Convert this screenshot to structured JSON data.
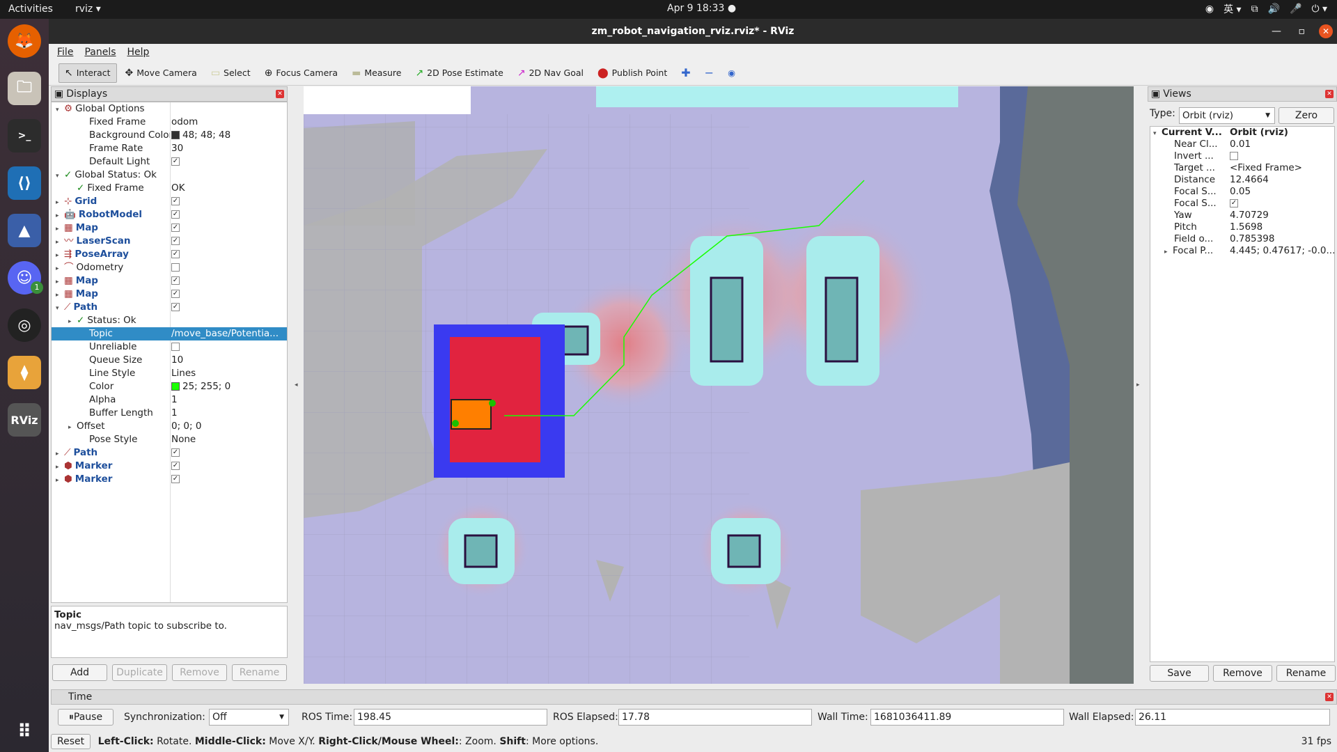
{
  "topbar": {
    "activities": "Activities",
    "app": "rviz ▾",
    "clock": "Apr 9  18:33  ●",
    "lang": "英 ▾"
  },
  "window": {
    "title": "zm_robot_navigation_rviz.rviz* - RViz"
  },
  "menu": [
    "File",
    "Panels",
    "Help"
  ],
  "toolbar": [
    {
      "label": "Interact",
      "icon": "cursor-icon",
      "glyph": "↖"
    },
    {
      "label": "Move Camera",
      "icon": "move-camera-icon",
      "glyph": "✥"
    },
    {
      "label": "Select",
      "icon": "select-icon",
      "glyph": "▭"
    },
    {
      "label": "Focus Camera",
      "icon": "focus-icon",
      "glyph": "⊕"
    },
    {
      "label": "Measure",
      "icon": "ruler-icon",
      "glyph": "▬"
    },
    {
      "label": "2D Pose Estimate",
      "icon": "pose-arrow-icon",
      "glyph": "↗"
    },
    {
      "label": "2D Nav Goal",
      "icon": "goal-arrow-icon",
      "glyph": "↗"
    },
    {
      "label": "Publish Point",
      "icon": "pin-icon",
      "glyph": "📍"
    }
  ],
  "displays": {
    "title": "Displays",
    "rows": [
      {
        "indent": 0,
        "arrow": "▾",
        "icon": "⚙",
        "label": "Global Options",
        "value": "",
        "bold": false
      },
      {
        "indent": 2,
        "arrow": "",
        "icon": "",
        "label": "Fixed Frame",
        "value": "odom"
      },
      {
        "indent": 2,
        "arrow": "",
        "icon": "",
        "label": "Background Color",
        "value": "48; 48; 48",
        "swatch": "#303030"
      },
      {
        "indent": 2,
        "arrow": "",
        "icon": "",
        "label": "Frame Rate",
        "value": "30"
      },
      {
        "indent": 2,
        "arrow": "",
        "icon": "",
        "label": "Default Light",
        "value": "",
        "check": true
      },
      {
        "indent": 0,
        "arrow": "▾",
        "icon": "✓",
        "label": "Global Status: Ok",
        "value": ""
      },
      {
        "indent": 1,
        "arrow": "",
        "icon": "✓",
        "label": "Fixed Frame",
        "value": "OK"
      },
      {
        "indent": 0,
        "arrow": "▸",
        "icon": "⊹",
        "label": "Grid",
        "value": "",
        "check": true,
        "blue": true
      },
      {
        "indent": 0,
        "arrow": "▸",
        "icon": "🤖",
        "label": "RobotModel",
        "value": "",
        "check": true,
        "blue": true
      },
      {
        "indent": 0,
        "arrow": "▸",
        "icon": "▦",
        "label": "Map",
        "value": "",
        "check": true,
        "blue": true
      },
      {
        "indent": 0,
        "arrow": "▸",
        "icon": "〰",
        "label": "LaserScan",
        "value": "",
        "check": true,
        "blue": true
      },
      {
        "indent": 0,
        "arrow": "▸",
        "icon": "⇶",
        "label": "PoseArray",
        "value": "",
        "check": true,
        "blue": true
      },
      {
        "indent": 0,
        "arrow": "▸",
        "icon": "⌒",
        "label": "Odometry",
        "value": "",
        "check": false
      },
      {
        "indent": 0,
        "arrow": "▸",
        "icon": "▦",
        "label": "Map",
        "value": "",
        "check": true,
        "blue": true
      },
      {
        "indent": 0,
        "arrow": "▸",
        "icon": "▦",
        "label": "Map",
        "value": "",
        "check": true,
        "blue": true
      },
      {
        "indent": 0,
        "arrow": "▾",
        "icon": "⟋",
        "label": "Path",
        "value": "",
        "check": true,
        "blue": true
      },
      {
        "indent": 1,
        "arrow": "▸",
        "icon": "✓",
        "label": "Status: Ok",
        "value": ""
      },
      {
        "indent": 2,
        "arrow": "",
        "icon": "",
        "label": "Topic",
        "value": "/move_base/Potentia...",
        "selected": true
      },
      {
        "indent": 2,
        "arrow": "",
        "icon": "",
        "label": "Unreliable",
        "value": "",
        "check": false
      },
      {
        "indent": 2,
        "arrow": "",
        "icon": "",
        "label": "Queue Size",
        "value": "10"
      },
      {
        "indent": 2,
        "arrow": "",
        "icon": "",
        "label": "Line Style",
        "value": "Lines"
      },
      {
        "indent": 2,
        "arrow": "",
        "icon": "",
        "label": "Color",
        "value": "25; 255; 0",
        "swatch": "#19ff00"
      },
      {
        "indent": 2,
        "arrow": "",
        "icon": "",
        "label": "Alpha",
        "value": "1"
      },
      {
        "indent": 2,
        "arrow": "",
        "icon": "",
        "label": "Buffer Length",
        "value": "1"
      },
      {
        "indent": 1,
        "arrow": "▸",
        "icon": "",
        "label": "Offset",
        "value": "0; 0; 0"
      },
      {
        "indent": 2,
        "arrow": "",
        "icon": "",
        "label": "Pose Style",
        "value": "None"
      },
      {
        "indent": 0,
        "arrow": "▸",
        "icon": "⟋",
        "label": "Path",
        "value": "",
        "check": true,
        "blue": true
      },
      {
        "indent": 0,
        "arrow": "▸",
        "icon": "⬢",
        "label": "Marker",
        "value": "",
        "check": true,
        "blue": true
      },
      {
        "indent": 0,
        "arrow": "▸",
        "icon": "⬢",
        "label": "Marker",
        "value": "",
        "check": true,
        "blue": true
      }
    ],
    "help_title": "Topic",
    "help_text": "nav_msgs/Path topic to subscribe to.",
    "buttons": {
      "add": "Add",
      "duplicate": "Duplicate",
      "remove": "Remove",
      "rename": "Rename"
    }
  },
  "views": {
    "title": "Views",
    "type_label": "Type:",
    "type_value": "Orbit (rviz)",
    "zero": "Zero",
    "rows": [
      {
        "arrow": "▾",
        "label": "Current V...",
        "value": "Orbit (rviz)",
        "bold": true
      },
      {
        "arrow": "",
        "label": "Near Cl...",
        "value": "0.01"
      },
      {
        "arrow": "",
        "label": "Invert ...",
        "value": "",
        "check": false
      },
      {
        "arrow": "",
        "label": "Target ...",
        "value": "<Fixed Frame>"
      },
      {
        "arrow": "",
        "label": "Distance",
        "value": "12.4664"
      },
      {
        "arrow": "",
        "label": "Focal S...",
        "value": "0.05"
      },
      {
        "arrow": "",
        "label": "Focal S...",
        "value": "",
        "check": true
      },
      {
        "arrow": "",
        "label": "Yaw",
        "value": "4.70729"
      },
      {
        "arrow": "",
        "label": "Pitch",
        "value": "1.5698"
      },
      {
        "arrow": "",
        "label": "Field o...",
        "value": "0.785398"
      },
      {
        "arrow": "▸",
        "label": "Focal P...",
        "value": "4.445; 0.47617; -0.0..."
      }
    ],
    "buttons": {
      "save": "Save",
      "remove": "Remove",
      "rename": "Rename"
    }
  },
  "time": {
    "title": "Time",
    "pause": "Pause",
    "sync_label": "Synchronization:",
    "sync_value": "Off",
    "ros_time_label": "ROS Time:",
    "ros_time": "198.45",
    "ros_elapsed_label": "ROS Elapsed:",
    "ros_elapsed": "17.78",
    "wall_time_label": "Wall Time:",
    "wall_time": "1681036411.89",
    "wall_elapsed_label": "Wall Elapsed:",
    "wall_elapsed": "26.11"
  },
  "status": {
    "reset": "Reset",
    "k1": "Left-Click:",
    "v1": " Rotate. ",
    "k2": "Middle-Click:",
    "v2": " Move X/Y. ",
    "k3": "Right-Click/Mouse Wheel:",
    "v3": ": Zoom. ",
    "k4": "Shift",
    "v4": ": More options.",
    "fps": "31 fps"
  },
  "colors": {
    "accent": "#308cc6",
    "path_green": "#19ff00",
    "costmap": "#b7b4df",
    "robot": "#ff7f00"
  }
}
